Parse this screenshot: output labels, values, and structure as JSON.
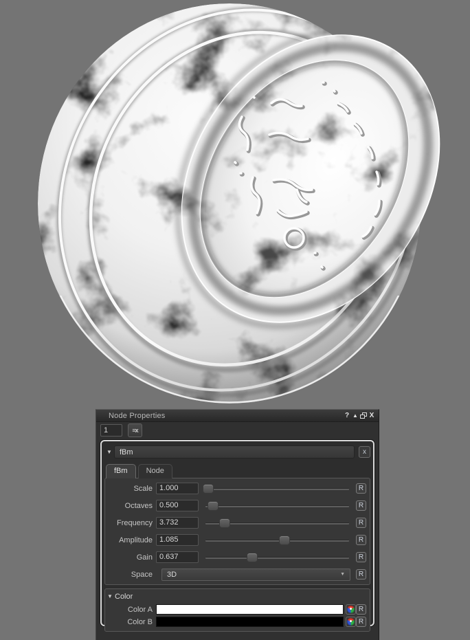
{
  "preview": {
    "background": "#747474"
  },
  "window": {
    "title": "Node Properties",
    "selector_value": "1",
    "icons": {
      "help": "?",
      "detach": "▲",
      "float": "overlapping-squares-css",
      "close": "X",
      "clear": "≡x"
    }
  },
  "node": {
    "collapse_glyph": "▼",
    "title": "fBm",
    "close_glyph": "x",
    "reset_label": "R",
    "tabs": [
      {
        "label": "fBm",
        "active": true
      },
      {
        "label": "Node",
        "active": false
      }
    ],
    "params": [
      {
        "label": "Scale",
        "value": "1.000",
        "slider_left": "1%"
      },
      {
        "label": "Octaves",
        "value": "0.500",
        "slider_left": "4%"
      },
      {
        "label": "Frequency",
        "value": "3.732",
        "slider_left": "12%"
      },
      {
        "label": "Amplitude",
        "value": "1.085",
        "slider_left": "53%"
      },
      {
        "label": "Gain",
        "value": "0.637",
        "slider_left": "31%"
      }
    ],
    "space": {
      "label": "Space",
      "value": "3D",
      "caret": "▼"
    },
    "color_section": {
      "collapse_glyph": "▼",
      "title": "Color",
      "rows": [
        {
          "label": "Color A",
          "swatch": "#ffffff"
        },
        {
          "label": "Color B",
          "swatch": "#000000"
        }
      ]
    }
  }
}
